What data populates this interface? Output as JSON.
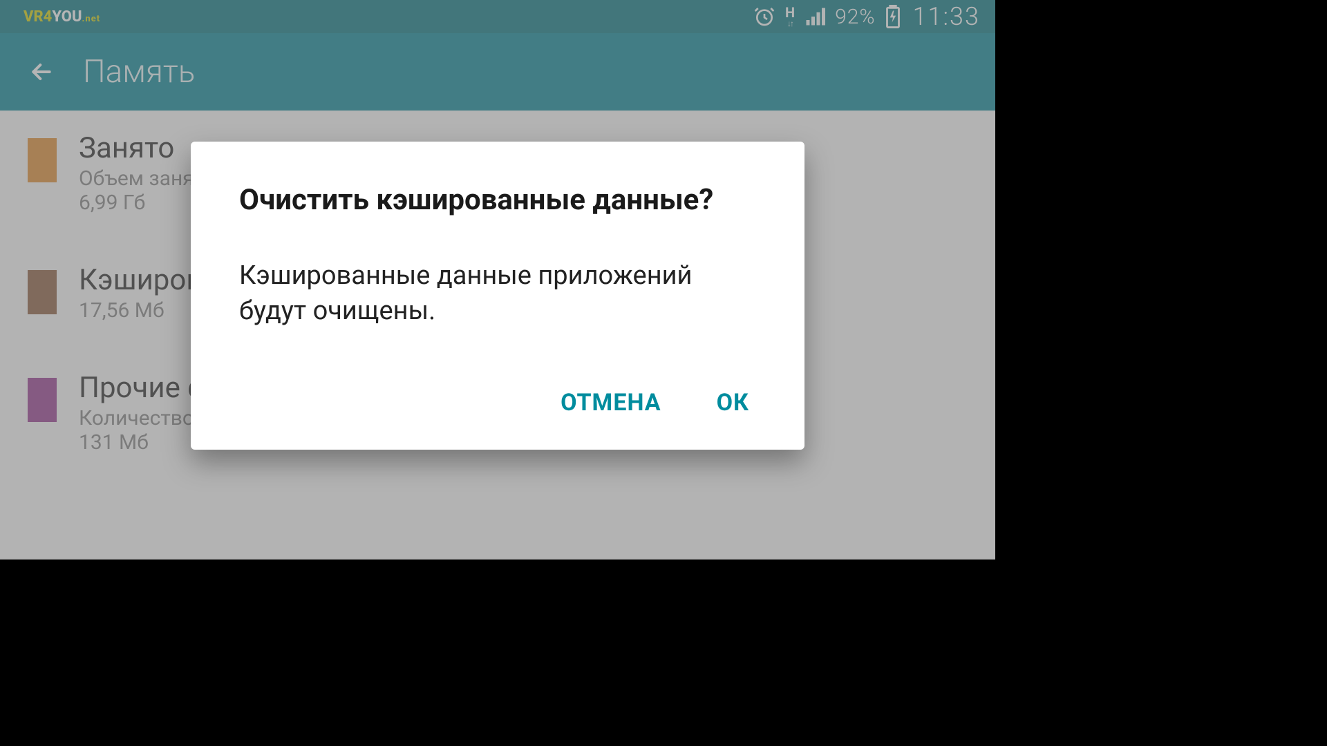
{
  "watermark": {
    "part1": "VR4",
    "part2": "YOU",
    "part3": ".net"
  },
  "status": {
    "network_badge": "H",
    "battery_pct": "92%",
    "clock": "11:33"
  },
  "appbar": {
    "title": "Память"
  },
  "storage": [
    {
      "swatch": "sw1",
      "title": "Занято",
      "line2": "Объем занятой памяти",
      "line3": "6,99 Гб"
    },
    {
      "swatch": "sw2",
      "title": "Кэшированные данные",
      "line2": "17,56 Мб",
      "line3": ""
    },
    {
      "swatch": "sw3",
      "title": "Прочие файлы",
      "line2": "Количество памяти для хранения различных файлов",
      "line3": "131 Мб"
    }
  ],
  "dialog": {
    "title": "Очистить кэшированные данные?",
    "body": "Кэшированные данные приложений будут очищены.",
    "cancel": "ОТМЕНА",
    "ok": "ОК"
  }
}
